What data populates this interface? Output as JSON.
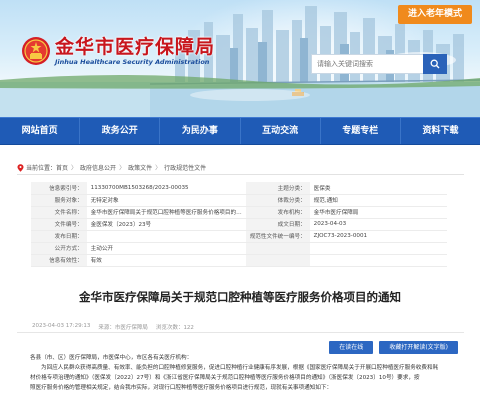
{
  "header": {
    "elderly_mode_label": "进入老年模式",
    "logo_cn": "金华市医疗保障局",
    "logo_en": "Jinhua Healthcare Security Administration",
    "search_placeholder": "请输入关键词搜索"
  },
  "nav": [
    {
      "label": "网站首页"
    },
    {
      "label": "政务公开"
    },
    {
      "label": "为民办事"
    },
    {
      "label": "互动交流"
    },
    {
      "label": "专题专栏"
    },
    {
      "label": "资料下载"
    }
  ],
  "breadcrumb": {
    "prefix": "当前位置：",
    "items": [
      "首页",
      "政府信息公开",
      "政策文件",
      "行政规范性文件"
    ]
  },
  "meta_rows": [
    {
      "l1": "信息索引号：",
      "v1": "11330700MB1503268/2023-00035",
      "l2": "主题分类：",
      "v2": "医保类"
    },
    {
      "l1": "服务对象：",
      "v1": "无特定对象",
      "l2": "体裁分类：",
      "v2": "规范,通知"
    },
    {
      "l1": "文件名称：",
      "v1": "金华市医疗保障局关于规范口腔种植等医疗服务价格项目的…",
      "l2": "发布机构：",
      "v2": "金华市医疗保障局"
    },
    {
      "l1": "文件编号：",
      "v1": "金医保发〔2023〕23号",
      "l2": "成文日期：",
      "v2": "2023-04-03"
    },
    {
      "l1": "发布日期：",
      "v1": "",
      "l2": "规范性文件统一编号：",
      "v2": "ZJOC73-2023-0001"
    },
    {
      "l1": "公开方式：",
      "v1": "主动公开",
      "l2": "",
      "v2": ""
    },
    {
      "l1": "信息有效性：",
      "v1": "有效",
      "l2": "",
      "v2": ""
    }
  ],
  "doc": {
    "title": "金华市医疗保障局关于规范口腔种植等医疗服务价格项目的通知",
    "date_text": "2023-04-03 17:29:13",
    "source_text": "来源：市医疗保障局",
    "views_text": "浏览次数：122",
    "btn_reader": "在读在线",
    "btn_download": "收藏打开解读(文字版)"
  },
  "body": {
    "salutation": "各县（市、区）医疗保障局，市医保中心，市区各有关医疗机构：",
    "line1": "为回应人民群众获得高质量、有效率、能负担的口腔种植修复服务，促进口腔种植行业健康有序发展，根据《国家医疗保障局关于开展口腔种植医疗服务收费和耗",
    "line2": "材价格专项治理的通知》（医保发〔2022〕27号）和《浙江省医疗保障局关于规范口腔种植等医疗服务价格项目的通知》（浙医保发〔2023〕10号）要求，按",
    "line3": "照医疗服务价格的管理相关规定，结合我市实际，对现行口腔种植等医疗服务价格项目进行规范，现就有关事项通知如下："
  }
}
